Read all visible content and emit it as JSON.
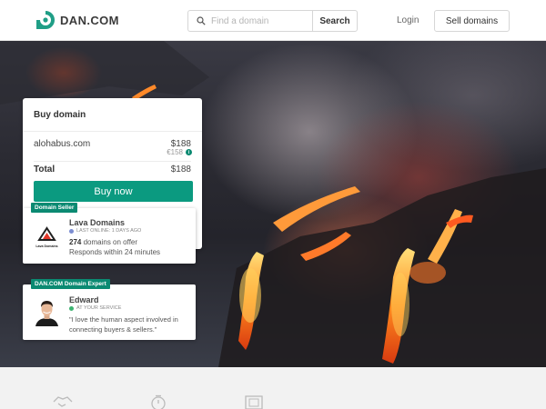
{
  "header": {
    "logo_text": "DAN.COM",
    "search_placeholder": "Find a domain",
    "search_label": "Search",
    "login_label": "Login",
    "sell_label": "Sell domains"
  },
  "buy_card": {
    "title": "Buy domain",
    "domain": "alohabus.com",
    "price_usd": "$188",
    "price_eur": "€158",
    "total_label": "Total",
    "total_value": "$188",
    "buy_label": "Buy now"
  },
  "seller_card": {
    "badge": "Domain Seller",
    "logo_text": "Lava Domains",
    "name": "Lava Domains",
    "status": "LAST ONLINE: 1 DAYS AGO",
    "status_color": "#7b8cd1",
    "offer_count": "274",
    "offer_text": " domains on offer",
    "respond": "Responds within 24 minutes"
  },
  "expert_card": {
    "badge": "DAN.COM Domain Expert",
    "name": "Edward",
    "status": "AT YOUR SERVICE",
    "status_color": "#3cb371",
    "quote": "\"I love the human aspect involved in connecting buyers & sellers.\""
  },
  "colors": {
    "accent": "#0b9a80",
    "badge": "#0b8a72"
  }
}
